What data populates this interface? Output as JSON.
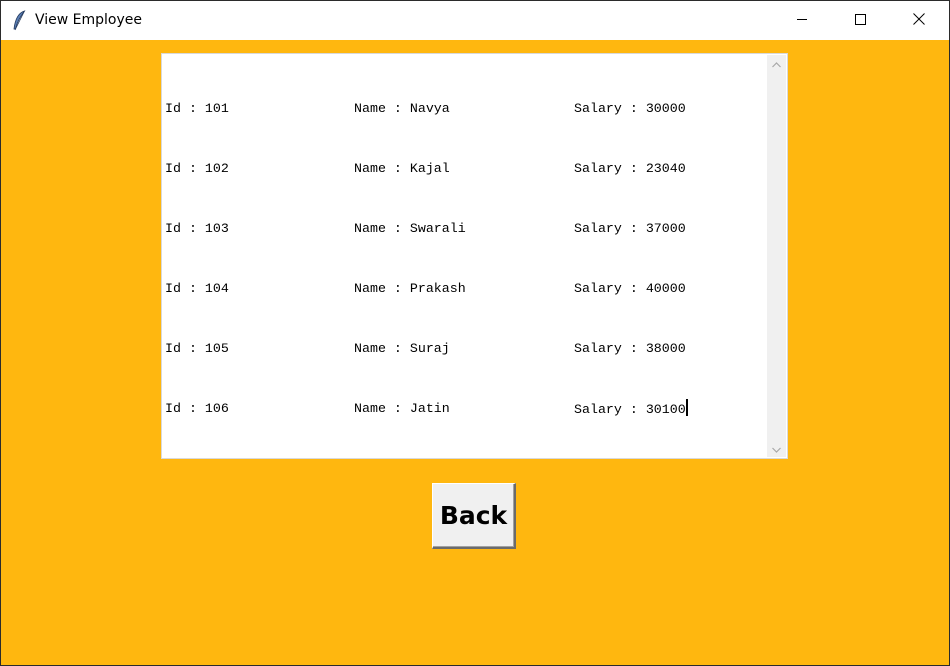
{
  "window": {
    "title": "View Employee",
    "icon": "feather-icon",
    "controls": [
      "minimize-icon",
      "maximize-icon",
      "close-icon"
    ]
  },
  "colors": {
    "background": "#ffb70f",
    "textbox": "#ffffff",
    "button": "#f0f0f0"
  },
  "employees": [
    {
      "id": "Id : 101",
      "name": "Name : Navya",
      "salary": "Salary : 30000"
    },
    {
      "id": "Id : 102",
      "name": "Name : Kajal",
      "salary": "Salary : 23040"
    },
    {
      "id": "Id : 103",
      "name": "Name : Swarali",
      "salary": "Salary : 37000"
    },
    {
      "id": "Id : 104",
      "name": "Name : Prakash",
      "salary": "Salary : 40000"
    },
    {
      "id": "Id : 105",
      "name": "Name : Suraj",
      "salary": "Salary : 38000"
    },
    {
      "id": "Id : 106",
      "name": "Name : Jatin",
      "salary": "Salary : 30100"
    }
  ],
  "back_button": {
    "label": "Back"
  }
}
